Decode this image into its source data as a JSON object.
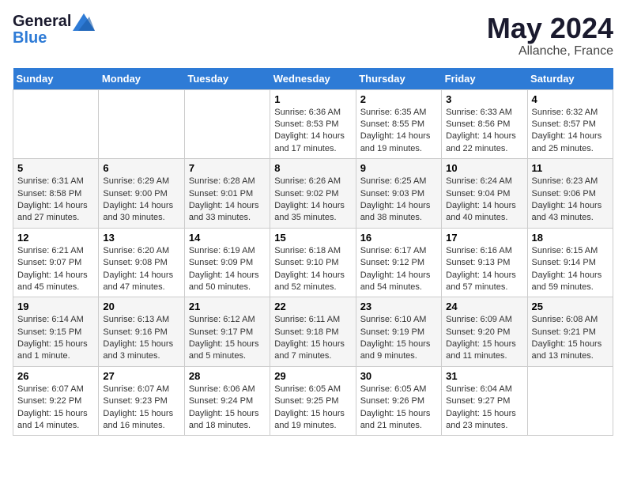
{
  "logo": {
    "line1": "General",
    "line2": "Blue"
  },
  "title": "May 2024",
  "subtitle": "Allanche, France",
  "days_header": [
    "Sunday",
    "Monday",
    "Tuesday",
    "Wednesday",
    "Thursday",
    "Friday",
    "Saturday"
  ],
  "weeks": [
    [
      {
        "day": "",
        "info": ""
      },
      {
        "day": "",
        "info": ""
      },
      {
        "day": "",
        "info": ""
      },
      {
        "day": "1",
        "info": "Sunrise: 6:36 AM\nSunset: 8:53 PM\nDaylight: 14 hours\nand 17 minutes."
      },
      {
        "day": "2",
        "info": "Sunrise: 6:35 AM\nSunset: 8:55 PM\nDaylight: 14 hours\nand 19 minutes."
      },
      {
        "day": "3",
        "info": "Sunrise: 6:33 AM\nSunset: 8:56 PM\nDaylight: 14 hours\nand 22 minutes."
      },
      {
        "day": "4",
        "info": "Sunrise: 6:32 AM\nSunset: 8:57 PM\nDaylight: 14 hours\nand 25 minutes."
      }
    ],
    [
      {
        "day": "5",
        "info": "Sunrise: 6:31 AM\nSunset: 8:58 PM\nDaylight: 14 hours\nand 27 minutes."
      },
      {
        "day": "6",
        "info": "Sunrise: 6:29 AM\nSunset: 9:00 PM\nDaylight: 14 hours\nand 30 minutes."
      },
      {
        "day": "7",
        "info": "Sunrise: 6:28 AM\nSunset: 9:01 PM\nDaylight: 14 hours\nand 33 minutes."
      },
      {
        "day": "8",
        "info": "Sunrise: 6:26 AM\nSunset: 9:02 PM\nDaylight: 14 hours\nand 35 minutes."
      },
      {
        "day": "9",
        "info": "Sunrise: 6:25 AM\nSunset: 9:03 PM\nDaylight: 14 hours\nand 38 minutes."
      },
      {
        "day": "10",
        "info": "Sunrise: 6:24 AM\nSunset: 9:04 PM\nDaylight: 14 hours\nand 40 minutes."
      },
      {
        "day": "11",
        "info": "Sunrise: 6:23 AM\nSunset: 9:06 PM\nDaylight: 14 hours\nand 43 minutes."
      }
    ],
    [
      {
        "day": "12",
        "info": "Sunrise: 6:21 AM\nSunset: 9:07 PM\nDaylight: 14 hours\nand 45 minutes."
      },
      {
        "day": "13",
        "info": "Sunrise: 6:20 AM\nSunset: 9:08 PM\nDaylight: 14 hours\nand 47 minutes."
      },
      {
        "day": "14",
        "info": "Sunrise: 6:19 AM\nSunset: 9:09 PM\nDaylight: 14 hours\nand 50 minutes."
      },
      {
        "day": "15",
        "info": "Sunrise: 6:18 AM\nSunset: 9:10 PM\nDaylight: 14 hours\nand 52 minutes."
      },
      {
        "day": "16",
        "info": "Sunrise: 6:17 AM\nSunset: 9:12 PM\nDaylight: 14 hours\nand 54 minutes."
      },
      {
        "day": "17",
        "info": "Sunrise: 6:16 AM\nSunset: 9:13 PM\nDaylight: 14 hours\nand 57 minutes."
      },
      {
        "day": "18",
        "info": "Sunrise: 6:15 AM\nSunset: 9:14 PM\nDaylight: 14 hours\nand 59 minutes."
      }
    ],
    [
      {
        "day": "19",
        "info": "Sunrise: 6:14 AM\nSunset: 9:15 PM\nDaylight: 15 hours\nand 1 minute."
      },
      {
        "day": "20",
        "info": "Sunrise: 6:13 AM\nSunset: 9:16 PM\nDaylight: 15 hours\nand 3 minutes."
      },
      {
        "day": "21",
        "info": "Sunrise: 6:12 AM\nSunset: 9:17 PM\nDaylight: 15 hours\nand 5 minutes."
      },
      {
        "day": "22",
        "info": "Sunrise: 6:11 AM\nSunset: 9:18 PM\nDaylight: 15 hours\nand 7 minutes."
      },
      {
        "day": "23",
        "info": "Sunrise: 6:10 AM\nSunset: 9:19 PM\nDaylight: 15 hours\nand 9 minutes."
      },
      {
        "day": "24",
        "info": "Sunrise: 6:09 AM\nSunset: 9:20 PM\nDaylight: 15 hours\nand 11 minutes."
      },
      {
        "day": "25",
        "info": "Sunrise: 6:08 AM\nSunset: 9:21 PM\nDaylight: 15 hours\nand 13 minutes."
      }
    ],
    [
      {
        "day": "26",
        "info": "Sunrise: 6:07 AM\nSunset: 9:22 PM\nDaylight: 15 hours\nand 14 minutes."
      },
      {
        "day": "27",
        "info": "Sunrise: 6:07 AM\nSunset: 9:23 PM\nDaylight: 15 hours\nand 16 minutes."
      },
      {
        "day": "28",
        "info": "Sunrise: 6:06 AM\nSunset: 9:24 PM\nDaylight: 15 hours\nand 18 minutes."
      },
      {
        "day": "29",
        "info": "Sunrise: 6:05 AM\nSunset: 9:25 PM\nDaylight: 15 hours\nand 19 minutes."
      },
      {
        "day": "30",
        "info": "Sunrise: 6:05 AM\nSunset: 9:26 PM\nDaylight: 15 hours\nand 21 minutes."
      },
      {
        "day": "31",
        "info": "Sunrise: 6:04 AM\nSunset: 9:27 PM\nDaylight: 15 hours\nand 23 minutes."
      },
      {
        "day": "",
        "info": ""
      }
    ]
  ],
  "colors": {
    "header_bg": "#2e7bd6",
    "header_text": "#ffffff",
    "title_color": "#1a1a2e"
  }
}
